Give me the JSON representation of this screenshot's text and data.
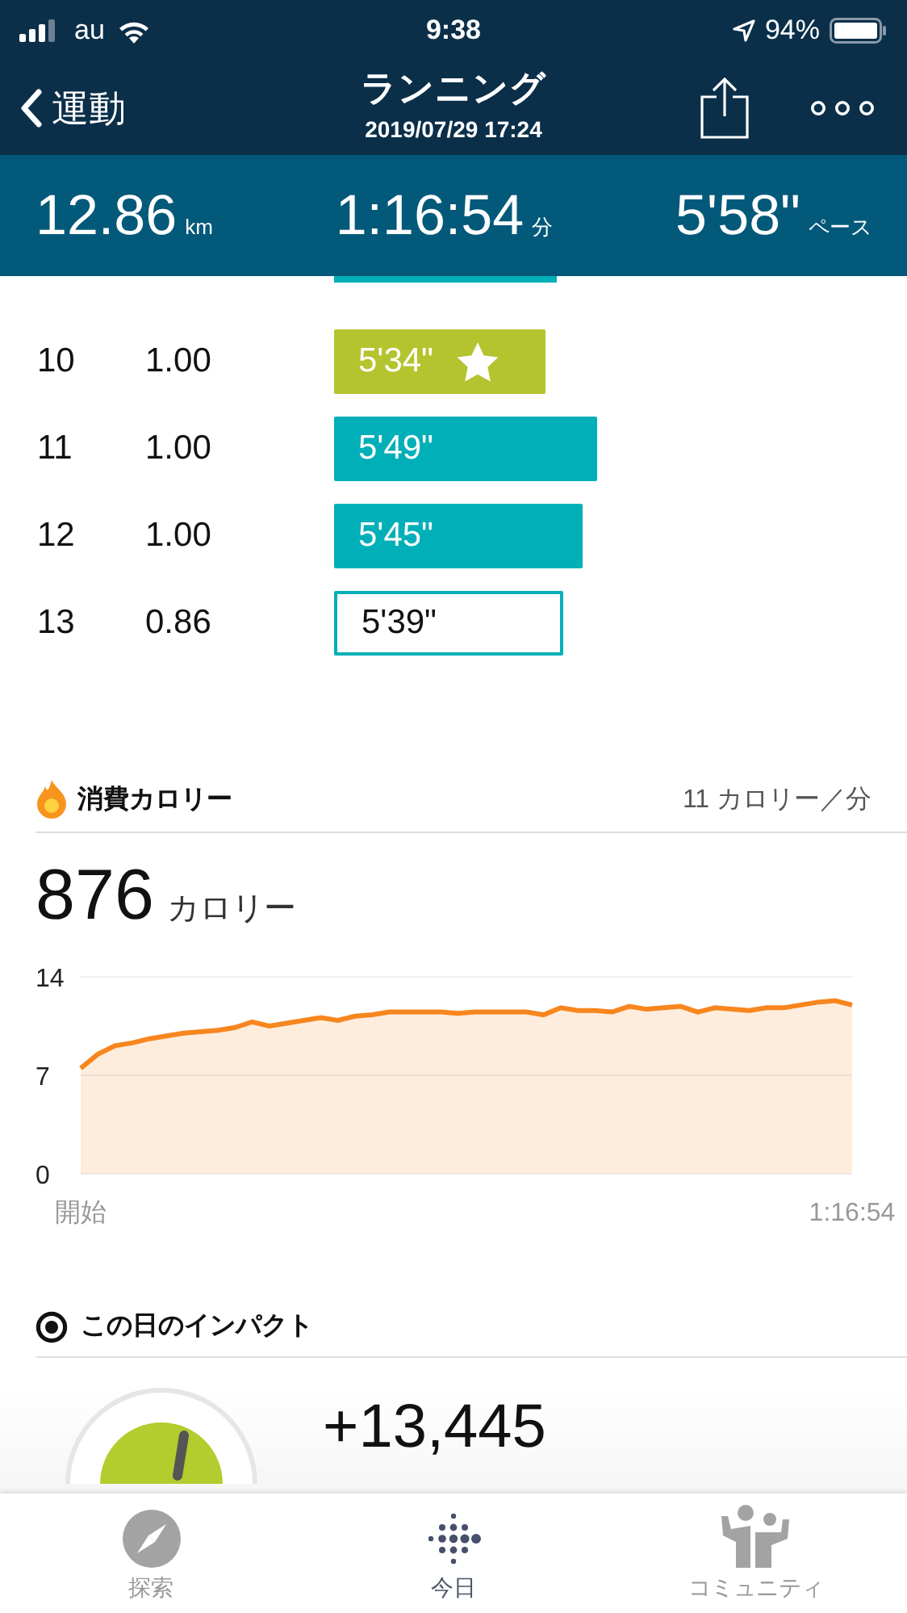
{
  "status_bar": {
    "carrier": "au",
    "time": "9:38",
    "battery": "94%"
  },
  "nav": {
    "back": "運動",
    "title": "ランニング",
    "subtitle": "2019/07/29 17:24"
  },
  "summary": [
    {
      "value": "12.86",
      "unit": "km"
    },
    {
      "value": "1:16:54",
      "unit": "分"
    },
    {
      "value": "5'58\"",
      "unit": "ペース"
    }
  ],
  "laps": [
    {
      "kind": "clipped"
    },
    {
      "kind": "best",
      "lap": "10",
      "distance": "1.00",
      "pace": "5'34\""
    },
    {
      "kind": "normal",
      "lap": "11",
      "distance": "1.00",
      "pace": "5'49\""
    },
    {
      "kind": "normal",
      "lap": "12",
      "distance": "1.00",
      "pace": "5'45\""
    },
    {
      "kind": "partial",
      "lap": "13",
      "distance": "0.86",
      "pace": "5'39\""
    }
  ],
  "calories": {
    "title": "消費カロリー",
    "rate": "11 カロリー／分",
    "value": "876",
    "unit": "カロリー",
    "chart_data": {
      "type": "area",
      "ylim": [
        0,
        14
      ],
      "yticks": [
        0,
        7,
        14
      ],
      "categories": [
        "開始",
        null,
        null,
        null,
        null,
        null,
        null,
        null,
        null,
        null,
        null,
        null,
        null,
        null,
        null,
        null,
        null,
        null,
        null,
        null,
        null,
        null,
        null,
        null,
        null,
        null,
        null,
        null,
        null,
        null,
        null,
        null,
        null,
        null,
        null,
        null,
        null,
        null,
        null,
        null,
        null,
        null,
        null,
        null,
        null,
        "1:16:54"
      ],
      "series": [
        {
          "color": "#f7861e",
          "values": [
            7.5,
            8.5,
            9.1,
            9.3,
            9.6,
            9.8,
            10.0,
            10.1,
            10.2,
            10.4,
            10.8,
            10.5,
            10.7,
            10.9,
            11.1,
            10.9,
            11.2,
            11.3,
            11.5,
            11.5,
            11.5,
            11.5,
            11.4,
            11.5,
            11.5,
            11.5,
            11.5,
            11.3,
            11.8,
            11.6,
            11.6,
            11.5,
            11.9,
            11.7,
            11.8,
            11.9,
            11.5,
            11.8,
            11.7,
            11.6,
            11.8,
            11.8,
            12.0,
            12.2,
            12.3,
            12.0
          ]
        }
      ]
    }
  },
  "impact": {
    "title": "この日のインパクト",
    "value": "+13,445"
  },
  "tabs": [
    {
      "label": "探索",
      "selected": false
    },
    {
      "label": "今日",
      "selected": true
    },
    {
      "label": "コミュニティ",
      "selected": false
    }
  ]
}
